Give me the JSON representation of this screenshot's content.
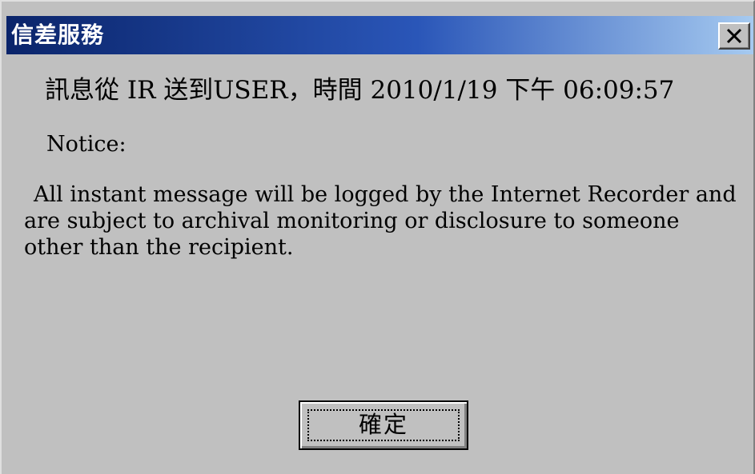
{
  "window": {
    "title": "信差服務",
    "close_icon": "close-x-icon"
  },
  "message": {
    "header": "訊息從 IR 送到USER，時間 2010/1/19 下午 06:09:57",
    "notice_label": "Notice:",
    "notice_body": "All instant message will be logged by the Internet Recorder and are subject to archival monitoring or disclosure to someone other than the recipient."
  },
  "buttons": {
    "ok_label": "確定"
  },
  "colors": {
    "title_bar_start": "#0a246a",
    "title_bar_end": "#a6caf0",
    "dialog_face": "#c0c0c0"
  }
}
